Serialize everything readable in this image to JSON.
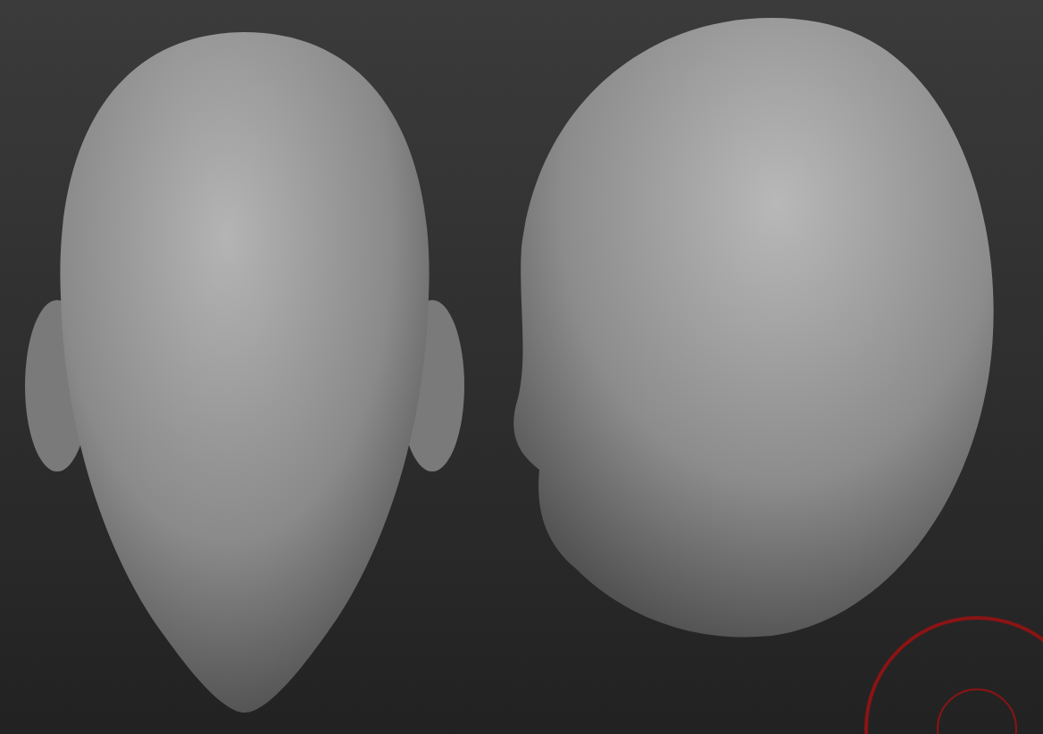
{
  "viewport": {
    "views": [
      {
        "kind": "front"
      },
      {
        "kind": "profile"
      }
    ],
    "brush_cursor": true
  }
}
